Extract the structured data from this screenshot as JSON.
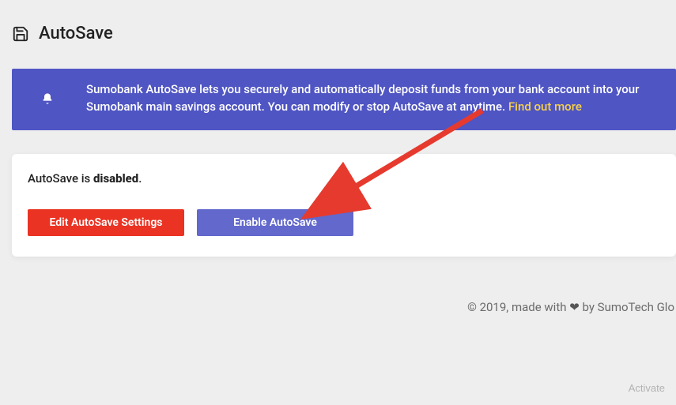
{
  "page": {
    "title": "AutoSave"
  },
  "banner": {
    "text": "Sumobank AutoSave lets you securely and automatically deposit funds from your bank account into your Sumobank main savings account. You can modify or stop AutoSave at anytime. ",
    "link_label": "Find out more"
  },
  "status": {
    "prefix": "AutoSave is ",
    "state": "disabled",
    "suffix": "."
  },
  "buttons": {
    "edit_label": "Edit AutoSave Settings",
    "enable_label": "Enable AutoSave"
  },
  "footer": {
    "copyright_prefix": "© 2019, made with ",
    "copyright_suffix": " by SumoTech Glo"
  },
  "watermark": {
    "line1": "Activate"
  }
}
